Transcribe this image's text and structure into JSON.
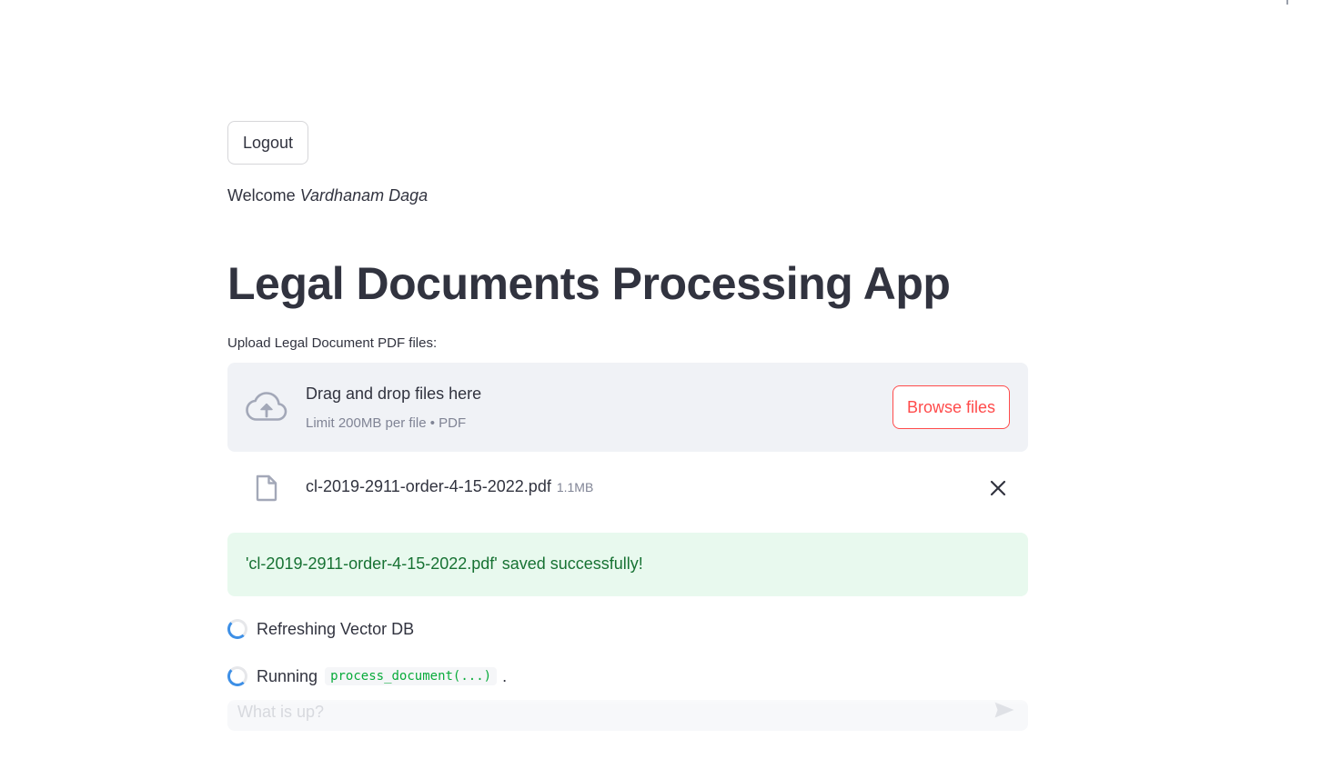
{
  "header": {
    "logout_label": "Logout"
  },
  "welcome": {
    "prefix": "Welcome ",
    "user_name": "Vardhanam Daga"
  },
  "page": {
    "title": "Legal Documents Processing App"
  },
  "uploader": {
    "label": "Upload Legal Document PDF files:",
    "drop_title": "Drag and drop files here",
    "drop_subtitle": "Limit 200MB per file • PDF",
    "browse_label": "Browse files",
    "icon": "cloud-upload-icon",
    "files": [
      {
        "name": "cl-2019-2911-order-4-15-2022.pdf",
        "size": "1.1MB",
        "icon": "file-icon"
      }
    ]
  },
  "alert": {
    "type": "success",
    "message": "'cl-2019-2911-order-4-15-2022.pdf' saved successfully!"
  },
  "status": {
    "refresh_text": "Refreshing Vector DB",
    "running_prefix": "Running",
    "running_code": "process_document(...)",
    "running_suffix": "."
  },
  "chat": {
    "placeholder": "What is up?",
    "send_icon": "send-icon"
  },
  "colors": {
    "primary": "#ff4b4b",
    "text": "#31333f",
    "muted": "#808495",
    "success_bg": "#e8f9ee",
    "success_text": "#177233",
    "dropzone_bg": "#f0f2f6",
    "code_text": "#09ab3b",
    "spinner": "#3d8fe6"
  }
}
